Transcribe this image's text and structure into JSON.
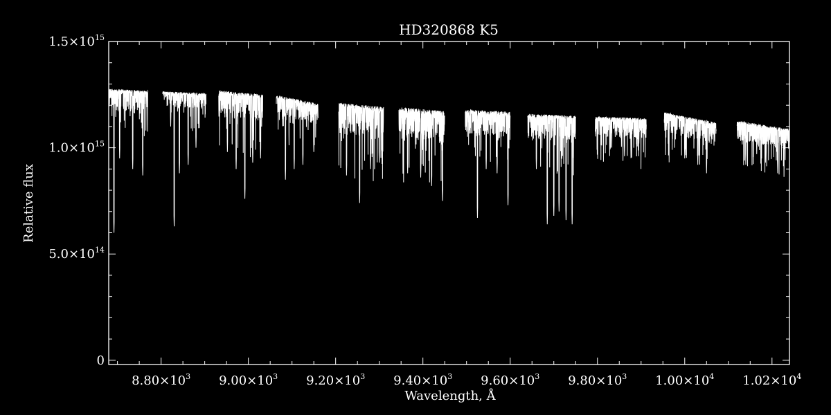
{
  "chart_data": {
    "type": "line",
    "title": "HD320868  K5",
    "xlabel": "Wavelength, Å",
    "ylabel": "Relative flux",
    "xlim": [
      8680,
      10240
    ],
    "ylim": [
      -20000000000000.0,
      1500000000000000.0
    ],
    "x_ticks": [
      {
        "value": 8800,
        "mant": "8.80",
        "exp": "3"
      },
      {
        "value": 9000,
        "mant": "9.00",
        "exp": "3"
      },
      {
        "value": 9200,
        "mant": "9.20",
        "exp": "3"
      },
      {
        "value": 9400,
        "mant": "9.40",
        "exp": "3"
      },
      {
        "value": 9600,
        "mant": "9.60",
        "exp": "3"
      },
      {
        "value": 9800,
        "mant": "9.80",
        "exp": "3"
      },
      {
        "value": 10000,
        "mant": "1.00",
        "exp": "4"
      },
      {
        "value": 10200,
        "mant": "1.02",
        "exp": "4"
      }
    ],
    "y_ticks": [
      {
        "value": 0,
        "mant": "0",
        "exp": ""
      },
      {
        "value": 500000000000000.0,
        "mant": "5.0",
        "exp": "14"
      },
      {
        "value": 1000000000000000.0,
        "mant": "1.0",
        "exp": "15"
      },
      {
        "value": 1500000000000000.0,
        "mant": "1.5",
        "exp": "15"
      }
    ],
    "segments": [
      {
        "x": [
          8680,
          8770
        ],
        "cont": [
          1270000000000000.0,
          1260000000000000.0
        ],
        "noise": 40000000000000.0,
        "lines": [
          [
            8692,
            600000000000000.0
          ],
          [
            8705,
            950000000000000.0
          ],
          [
            8735,
            900000000000000.0
          ],
          [
            8758,
            870000000000000.0
          ]
        ]
      },
      {
        "x": [
          8803,
          8903
        ],
        "cont": [
          1260000000000000.0,
          1250000000000000.0
        ],
        "noise": 30000000000000.0,
        "lines": [
          [
            8822,
            1100000000000000.0
          ],
          [
            8830,
            630000000000000.0
          ],
          [
            8842,
            880000000000000.0
          ],
          [
            8862,
            920000000000000.0
          ],
          [
            8880,
            1000000000000000.0
          ]
        ]
      },
      {
        "x": [
          8932,
          9033
        ],
        "cont": [
          1260000000000000.0,
          1240000000000000.0
        ],
        "noise": 50000000000000.0,
        "lines": [
          [
            8952,
            980000000000000.0
          ],
          [
            8972,
            900000000000000.0
          ],
          [
            8992,
            760000000000000.0
          ],
          [
            9010,
            930000000000000.0
          ],
          [
            9028,
            950000000000000.0
          ]
        ]
      },
      {
        "x": [
          9064,
          9160
        ],
        "cont": [
          1240000000000000.0,
          1200000000000000.0
        ],
        "noise": 40000000000000.0,
        "lines": [
          [
            9085,
            850000000000000.0
          ],
          [
            9105,
            900000000000000.0
          ],
          [
            9125,
            920000000000000.0
          ],
          [
            9150,
            980000000000000.0
          ]
        ]
      },
      {
        "x": [
          9207,
          9310
        ],
        "cont": [
          1200000000000000.0,
          1180000000000000.0
        ],
        "noise": 60000000000000.0,
        "lines": [
          [
            9225,
            870000000000000.0
          ],
          [
            9255,
            740000000000000.0
          ],
          [
            9280,
            900000000000000.0
          ],
          [
            9300,
            930000000000000.0
          ]
        ]
      },
      {
        "x": [
          9345,
          9450
        ],
        "cont": [
          1180000000000000.0,
          1160000000000000.0
        ],
        "noise": 60000000000000.0,
        "lines": [
          [
            9365,
            880000000000000.0
          ],
          [
            9395,
            860000000000000.0
          ],
          [
            9420,
            820000000000000.0
          ],
          [
            9445,
            750000000000000.0
          ]
        ]
      },
      {
        "x": [
          9497,
          9600
        ],
        "cont": [
          1170000000000000.0,
          1160000000000000.0
        ],
        "noise": 50000000000000.0,
        "lines": [
          [
            9525,
            670000000000000.0
          ],
          [
            9545,
            900000000000000.0
          ],
          [
            9570,
            880000000000000.0
          ],
          [
            9595,
            730000000000000.0
          ]
        ]
      },
      {
        "x": [
          9640,
          9750
        ],
        "cont": [
          1150000000000000.0,
          1140000000000000.0
        ],
        "noise": 50000000000000.0,
        "lines": [
          [
            9660,
            900000000000000.0
          ],
          [
            9685,
            640000000000000.0
          ],
          [
            9700,
            680000000000000.0
          ],
          [
            9712,
            700000000000000.0
          ],
          [
            9728,
            660000000000000.0
          ],
          [
            9742,
            640000000000000.0
          ]
        ]
      },
      {
        "x": [
          9795,
          9912
        ],
        "cont": [
          1140000000000000.0,
          1130000000000000.0
        ],
        "noise": 40000000000000.0,
        "lines": [
          [
            9830,
            1000000000000000.0
          ],
          [
            9862,
            960000000000000.0
          ],
          [
            9895,
            1020000000000000.0
          ]
        ]
      },
      {
        "x": [
          9953,
          10072
        ],
        "cont": [
          1160000000000000.0,
          1110000000000000.0
        ],
        "noise": 40000000000000.0,
        "lines": [
          [
            10000,
            950000000000000.0
          ],
          [
            10030,
            920000000000000.0
          ],
          [
            10050,
            880000000000000.0
          ]
        ]
      },
      {
        "x": [
          10120,
          10240
        ],
        "cont": [
          1120000000000000.0,
          1080000000000000.0
        ],
        "noise": 40000000000000.0,
        "lines": [
          [
            10140,
            920000000000000.0
          ],
          [
            10165,
            970000000000000.0
          ],
          [
            10185,
            930000000000000.0
          ],
          [
            10213,
            880000000000000.0
          ]
        ]
      }
    ]
  }
}
